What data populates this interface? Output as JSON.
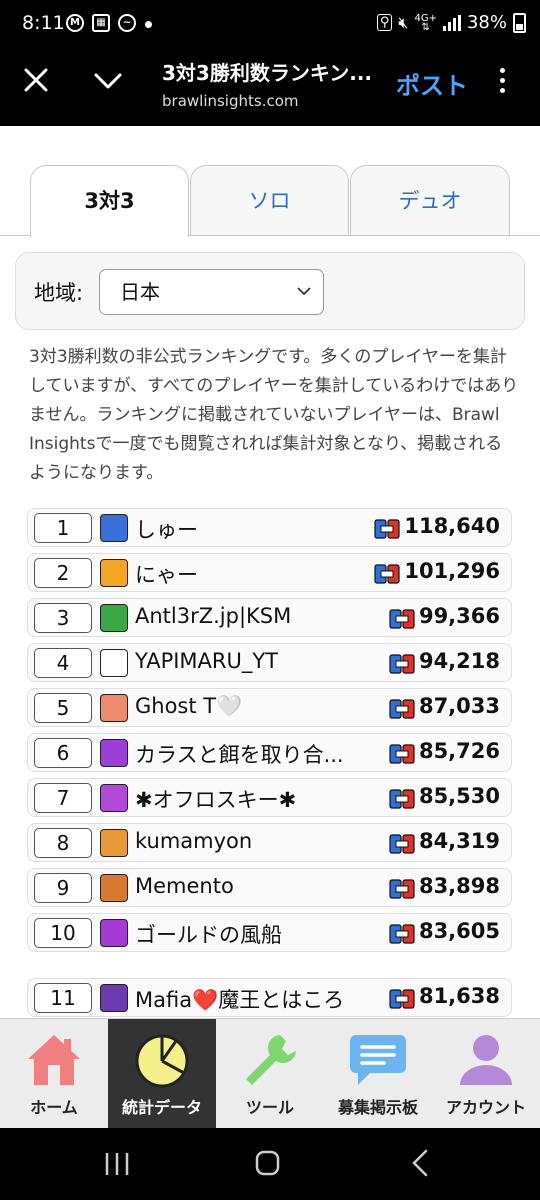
{
  "status_bar": {
    "time": "8:11",
    "network": "4G+",
    "battery": "38%"
  },
  "app_bar": {
    "title": "3対3勝利数ランキン...",
    "url": "brawlinsights.com",
    "post_label": "ポスト"
  },
  "tabs": [
    {
      "label": "3対3",
      "active": true
    },
    {
      "label": "ソロ",
      "active": false
    },
    {
      "label": "デュオ",
      "active": false
    }
  ],
  "region": {
    "label": "地域:",
    "selected": "日本"
  },
  "description": "3対3勝利数の非公式ランキングです。多くのプレイヤーを集計していますが、すべてのプレイヤーを集計しているわけではありません。ランキングに掲載されていないプレイヤーは、Brawl Insightsで一度でも閲覧されれば集計対象となり、掲載されるようになります。",
  "rankings": [
    {
      "rank": "1",
      "name": "しゅー",
      "wins": "118,640",
      "avatar_color": "#3b6fd8"
    },
    {
      "rank": "2",
      "name": "にゃー",
      "wins": "101,296",
      "avatar_color": "#f2a623"
    },
    {
      "rank": "3",
      "name": "Antl3rZ.jp|KSM",
      "wins": "99,366",
      "avatar_color": "#3aa845"
    },
    {
      "rank": "4",
      "name": "YAPIMARU_YT",
      "wins": "94,218",
      "avatar_color": "#ffffff"
    },
    {
      "rank": "5",
      "name": "Ghost T🤍",
      "wins": "87,033",
      "avatar_color": "#f08a6c"
    },
    {
      "rank": "6",
      "name": "カラスと餌を取り合...",
      "wins": "85,726",
      "avatar_color": "#9b3fd6"
    },
    {
      "rank": "7",
      "name": "✱オフロスキー✱",
      "wins": "85,530",
      "avatar_color": "#b14ad8"
    },
    {
      "rank": "8",
      "name": "kumamyon",
      "wins": "84,319",
      "avatar_color": "#e9983a"
    },
    {
      "rank": "9",
      "name": "Memento",
      "wins": "83,898",
      "avatar_color": "#d8792f"
    },
    {
      "rank": "10",
      "name": "ゴールドの風船",
      "wins": "83,605",
      "avatar_color": "#a53ad6"
    },
    {
      "rank": "11",
      "name": "Mafia❤️魔王とはころ",
      "wins": "81,638",
      "avatar_color": "#6a3bb0"
    }
  ],
  "bottom_nav": [
    {
      "label": "ホーム",
      "icon": "home-icon",
      "color": "#f08080",
      "active": false
    },
    {
      "label": "統計データ",
      "icon": "pie-chart-icon",
      "color": "#f4f08a",
      "active": true
    },
    {
      "label": "ツール",
      "icon": "wrench-icon",
      "color": "#7fd66e",
      "active": false
    },
    {
      "label": "募集掲示板",
      "icon": "chat-bubble-icon",
      "color": "#6cb4f0",
      "active": false
    },
    {
      "label": "アカウント",
      "icon": "user-icon",
      "color": "#b48ad8",
      "active": false
    }
  ]
}
